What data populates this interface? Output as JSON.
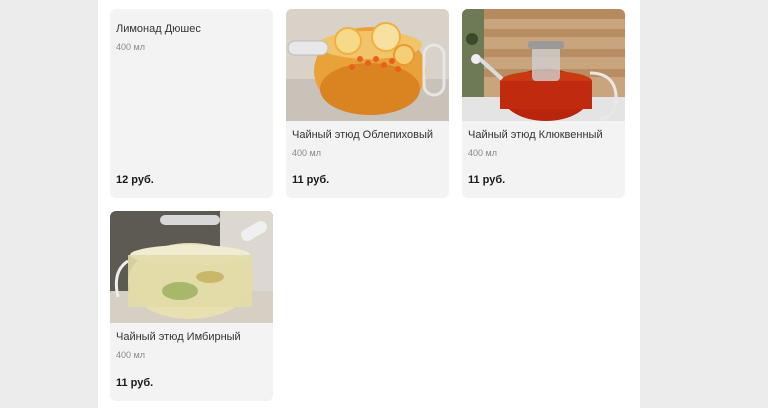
{
  "products": [
    {
      "name": "Лимонад Дюшес",
      "volume": "400 мл",
      "price": "12 руб."
    },
    {
      "name": "Чайный этюд Облепиховый",
      "volume": "400 мл",
      "price": "11 руб.",
      "image": "sea-buckthorn-tea-teapot"
    },
    {
      "name": "Чайный этюд Клюквенный",
      "volume": "400 мл",
      "price": "11 руб.",
      "image": "cranberry-tea-teapot"
    },
    {
      "name": "Чайный этюд Имбирный",
      "volume": "400 мл",
      "price": "11 руб.",
      "image": "ginger-tea-teapot"
    }
  ]
}
